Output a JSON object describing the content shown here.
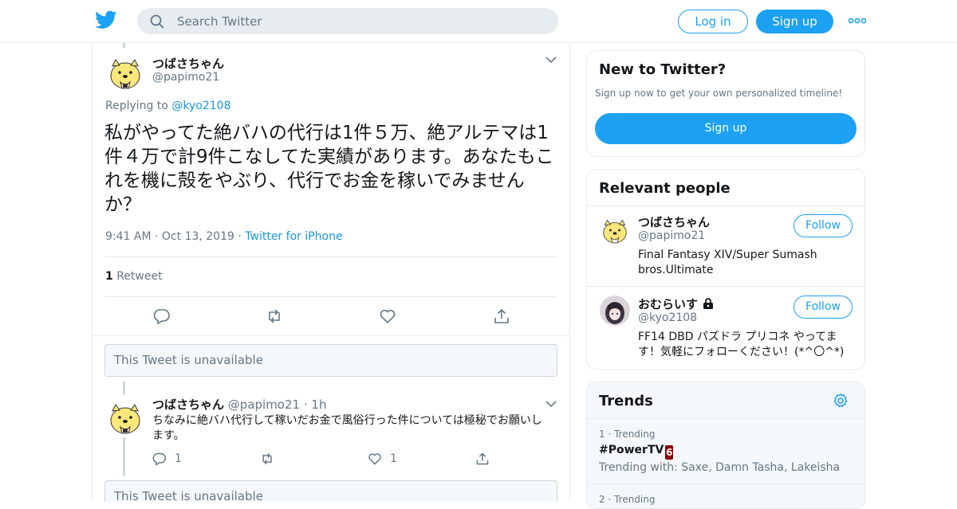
{
  "header": {
    "search_placeholder": "Search Twitter",
    "login_label": "Log in",
    "signup_label": "Sign up"
  },
  "tweet": {
    "name": "つばさちゃん",
    "handle": "@papimo21",
    "replying_prefix": "Replying to",
    "replying_to": "@kyo2108",
    "text": "私がやってた絶バハの代行は1件５万、絶アルテマは1件４万で計9件こなしてた実績があります。あなたもこれを機に殻をやぶり、代行でお金を稼いでみませんか？",
    "time": "9:41 AM",
    "date": "Oct 13, 2019",
    "source": "Twitter for iPhone",
    "retweet_count": "1",
    "retweet_label": "Retweet"
  },
  "unavailable_text": "This Tweet is unavailable",
  "reply": {
    "name": "つばさちゃん",
    "handle": "@papimo21",
    "age": "1h",
    "text": "ちなみに絶バハ代行して稼いだお金で風俗行った件については極秘でお願いします。",
    "reply_count": "1",
    "like_count": "1"
  },
  "new_to_twitter": {
    "title": "New to Twitter?",
    "subtitle": "Sign up now to get your own personalized timeline!",
    "button": "Sign up"
  },
  "relevant_people": {
    "title": "Relevant people",
    "people": [
      {
        "name": "つばさちゃん",
        "handle": "@papimo21",
        "bio": "Final Fantasy XIV/Super Sumash bros.Ultimate",
        "follow": "Follow"
      },
      {
        "name": "おむらいす",
        "handle": "@kyo2108",
        "bio": "FF14 DBD パズドラ プリコネ やってます！気軽にフォローください！(*^〇^*)",
        "follow": "Follow"
      }
    ]
  },
  "trends": {
    "title": "Trends",
    "items": [
      {
        "rank": "1 · Trending",
        "name": "#PowerTV",
        "with": "Trending with: Saxe, Damn Tasha, Lakeisha"
      },
      {
        "rank": "2 · Trending"
      }
    ]
  },
  "colors": {
    "brand": "#1da1f2",
    "link": "#1b95e0",
    "muted": "#657786",
    "border": "#e6ecf0"
  }
}
